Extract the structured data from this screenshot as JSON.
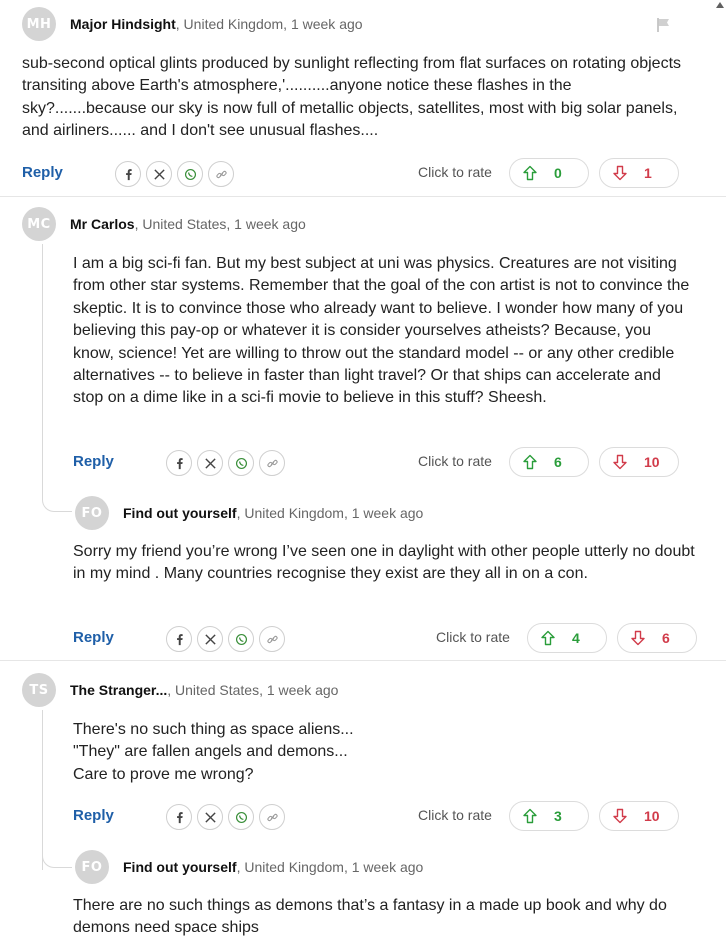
{
  "comments": [
    {
      "initials": "MH",
      "author": "Major Hindsight",
      "location": ", United Kingdom, 1 week ago",
      "body": [
        "sub-second optical glints produced by sunlight reflecting from flat surfaces on rotating objects transiting above Earth's atmosphere,'..........anyone notice these flashes in the sky?.......because our sky is now full of metallic objects, satellites, most with big solar panels, and airliners...... and I don't see unusual flashes...."
      ],
      "reply": "Reply",
      "rate_label": "Click to rate",
      "up": "0",
      "down": "1"
    },
    {
      "initials": "MC",
      "author": "Mr Carlos",
      "location": ", United States, 1 week ago",
      "body": [
        "I am a big sci-fi fan. But my best subject at uni was physics. Creatures are not visiting from other star systems. Remember that the goal of the con artist is not to convince the skeptic. It is to convince those who already want to believe. I wonder how many of you believing this pay-op or whatever it is consider yourselves atheists? Because, you know, science! Yet are willing to throw out the standard model -- or any other credible alternatives -- to believe in faster than light travel? Or that ships can accelerate and stop on a dime like in a sci-fi movie to believe in this stuff? Sheesh."
      ],
      "reply": "Reply",
      "rate_label": "Click to rate",
      "up": "6",
      "down": "10"
    },
    {
      "initials": "FO",
      "author": "Find out yourself",
      "location": ", United Kingdom, 1 week ago",
      "body": [
        "Sorry my friend you’re wrong I’ve seen one in daylight with other people utterly no doubt in my mind . Many countries recognise they exist are they all in on a con."
      ],
      "reply": "Reply",
      "rate_label": "Click to rate",
      "up": "4",
      "down": "6"
    },
    {
      "initials": "TS",
      "author": "The Stranger...",
      "location": ", United States, 1 week ago",
      "body": [
        "There's no such thing as space aliens...",
        "\"They\" are fallen angels and demons...",
        "Care to prove me wrong?"
      ],
      "reply": "Reply",
      "rate_label": "Click to rate",
      "up": "3",
      "down": "10"
    },
    {
      "initials": "FO",
      "author": "Find out yourself",
      "location": ", United Kingdom, 1 week ago",
      "body": [
        "There are no such things as demons that’s a fantasy in a made up book and why do demons need space ships"
      ]
    }
  ],
  "share_icons": [
    "facebook-icon",
    "x-icon",
    "whatsapp-icon",
    "link-icon"
  ],
  "colors": {
    "reply": "#1f5fa8",
    "upvote": "#2a9d3a",
    "downvote": "#d13b4a",
    "avatar_bg": "#d4d4d4"
  }
}
